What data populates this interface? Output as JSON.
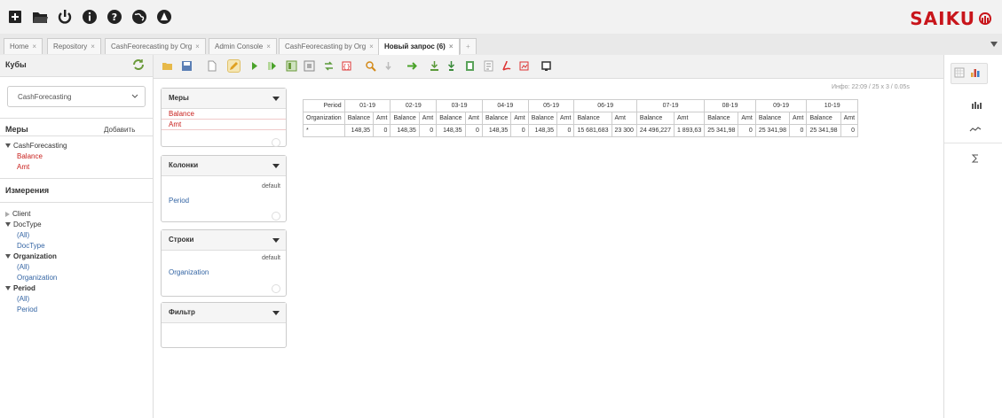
{
  "brand": {
    "name": "SAIKU",
    "color": "#c8151b"
  },
  "top_icons": [
    "new-query-icon",
    "open-folder-icon",
    "power-icon",
    "info-icon",
    "help-icon",
    "globe-icon",
    "admin-icon"
  ],
  "tabs": [
    {
      "label": "Home",
      "close": "×"
    },
    {
      "label": "Repository",
      "close": "×"
    },
    {
      "label": "CashFeorecasting by Org",
      "close": "×"
    },
    {
      "label": "Admin Console",
      "close": "×"
    },
    {
      "label": "CashFeorecasting by Org",
      "close": "×"
    },
    {
      "label": "Новый запрос (6)",
      "close": "×",
      "active": true
    }
  ],
  "tab_add": "+",
  "sidebar": {
    "cubes_title": "Кубы",
    "cube_selected": "CashForecasting",
    "measures_title": "Меры",
    "add_label": "Добавить",
    "cube_group": "CashForecasting",
    "measures": [
      "Balance",
      "Amt"
    ],
    "dimensions_title": "Измерения",
    "dimensions": [
      {
        "name": "Client",
        "expanded": false,
        "levels": []
      },
      {
        "name": "DocType",
        "expanded": true,
        "levels": [
          "(All)",
          "DocType"
        ]
      },
      {
        "name": "Organization",
        "expanded": true,
        "levels": [
          "(All)",
          "Organization"
        ]
      },
      {
        "name": "Period",
        "expanded": true,
        "levels": [
          "(All)",
          "Period"
        ]
      }
    ]
  },
  "panels": {
    "measures": {
      "title": "Меры",
      "items": [
        "Balance",
        "Amt"
      ]
    },
    "columns": {
      "title": "Колонки",
      "default": "default",
      "field": "Period"
    },
    "rows": {
      "title": "Строки",
      "default": "default",
      "field": "Organization"
    },
    "filter": {
      "title": "Фильтр"
    }
  },
  "info": "Инфо: 22:09  / 25 x 3 / 0.05s",
  "grid": {
    "period_label": "Period",
    "org_label": "Organization",
    "periods": [
      "01-19",
      "02-19",
      "03-19",
      "04-19",
      "05-19",
      "06-19",
      "07-19",
      "08-19",
      "09-19",
      "10-19"
    ],
    "measure_labels": [
      "Balance",
      "Amt"
    ],
    "row_label": "*",
    "balance": [
      "148,35",
      "148,35",
      "148,35",
      "148,35",
      "148,35",
      "15 681,683",
      "24 496,227",
      "25 341,98",
      "25 341,98",
      "25 341,98"
    ],
    "amt": [
      "0",
      "0",
      "0",
      "0",
      "0",
      "23 300",
      "1 893,63",
      "0",
      "0",
      "0"
    ]
  },
  "right_icons": [
    "table-view-icon",
    "bar-chart-icon",
    "column-chart-icon",
    "line-chart-icon",
    "sigma-icon"
  ]
}
